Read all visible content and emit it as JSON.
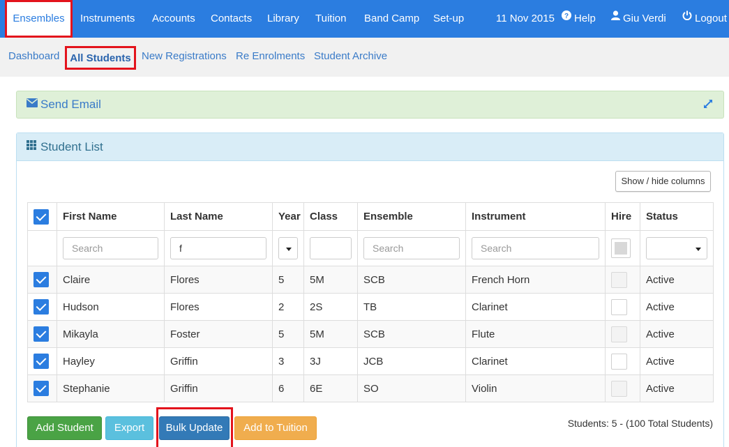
{
  "topnav": {
    "items": [
      "Ensembles",
      "Instruments",
      "Accounts",
      "Contacts",
      "Library",
      "Tuition",
      "Band Camp",
      "Set-up"
    ],
    "date": "11 Nov 2015",
    "help": "Help",
    "user": "Giu Verdi",
    "logout": "Logout"
  },
  "subnav": {
    "items": [
      "Dashboard",
      "All Students",
      "New Registrations",
      "Re Enrolments",
      "Student Archive"
    ]
  },
  "email_panel": {
    "title": "Send Email"
  },
  "list_panel": {
    "title": "Student List",
    "show_hide_label": "Show / hide columns"
  },
  "table": {
    "headers": [
      "First Name",
      "Last Name",
      "Year",
      "Class",
      "Ensemble",
      "Instrument",
      "Hire",
      "Status"
    ],
    "filters": {
      "first_name_placeholder": "Search",
      "last_name_value": "f",
      "ensemble_placeholder": "Search",
      "instrument_placeholder": "Search"
    },
    "rows": [
      {
        "first": "Claire",
        "last": "Flores",
        "year": "5",
        "class": "5M",
        "ensemble": "SCB",
        "instrument": "French Horn",
        "status": "Active"
      },
      {
        "first": "Hudson",
        "last": "Flores",
        "year": "2",
        "class": "2S",
        "ensemble": "TB",
        "instrument": "Clarinet",
        "status": "Active"
      },
      {
        "first": "Mikayla",
        "last": "Foster",
        "year": "5",
        "class": "5M",
        "ensemble": "SCB",
        "instrument": "Flute",
        "status": "Active"
      },
      {
        "first": "Hayley",
        "last": "Griffin",
        "year": "3",
        "class": "3J",
        "ensemble": "JCB",
        "instrument": "Clarinet",
        "status": "Active"
      },
      {
        "first": "Stephanie",
        "last": "Griffin",
        "year": "6",
        "class": "6E",
        "ensemble": "SO",
        "instrument": "Violin",
        "status": "Active"
      }
    ]
  },
  "buttons": {
    "add_student": "Add Student",
    "export": "Export",
    "bulk_update": "Bulk Update",
    "add_to_tuition": "Add to Tuition"
  },
  "footer": {
    "count": "Students: 5 - (100 Total Students)"
  },
  "colors": {
    "brand": "#2b7de0",
    "highlight": "#e3131c",
    "success": "#4aa345",
    "info": "#5bc0de",
    "primary": "#337ab7",
    "warning": "#f0ad4e"
  }
}
